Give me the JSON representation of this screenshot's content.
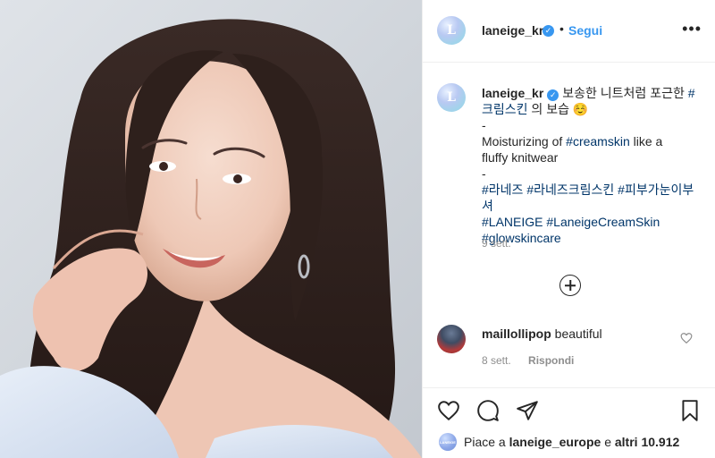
{
  "header": {
    "username": "laneige_kr",
    "avatar_letter": "L",
    "separator": "•",
    "follow_label": "Segui",
    "more_icon": "more-horizontal-icon",
    "verified_mark": "✓"
  },
  "caption": {
    "username": "laneige_kr",
    "avatar_letter": "L",
    "verified_mark": "✓",
    "line1_text": "보송한 니트처럼 포근한",
    "line1_tag": "#",
    "line2_tag": "크림스킨",
    "line2_text": "의 보습 ☺️",
    "dash1": "-",
    "line3_text": "Moisturizing of",
    "line3_tag": "#creamskin",
    "line3_tail": "like a",
    "line4_text": "fluffy knitwear",
    "dash2": "-",
    "tags_line1": [
      "#라네즈",
      "#라네즈크림스킨",
      "#피부가눈이부셔"
    ],
    "tags_line2": [
      "#LANEIGE",
      "#LaneigeCreamSkin"
    ],
    "tags_line3": [
      "#glowskincare"
    ],
    "time": "9 sett."
  },
  "load_more_icon": "plus-circle-icon",
  "reply": {
    "username": "maillollipop",
    "text": "beautiful",
    "time": "8 sett.",
    "reply_label": "Rispondi"
  },
  "actions": {
    "icons": [
      "heart-icon",
      "comment-icon",
      "share-icon",
      "bookmark-icon"
    ]
  },
  "likes": {
    "mini_avatar_text": "LANEIGE",
    "prefix": "Piace a",
    "user": "laneige_europe",
    "conj": "e",
    "others": "altri 10.912"
  },
  "colors": {
    "link": "#3897f0",
    "hashtag": "#003569",
    "muted": "#8e8e8e",
    "text": "#262626",
    "border": "#efefef"
  }
}
